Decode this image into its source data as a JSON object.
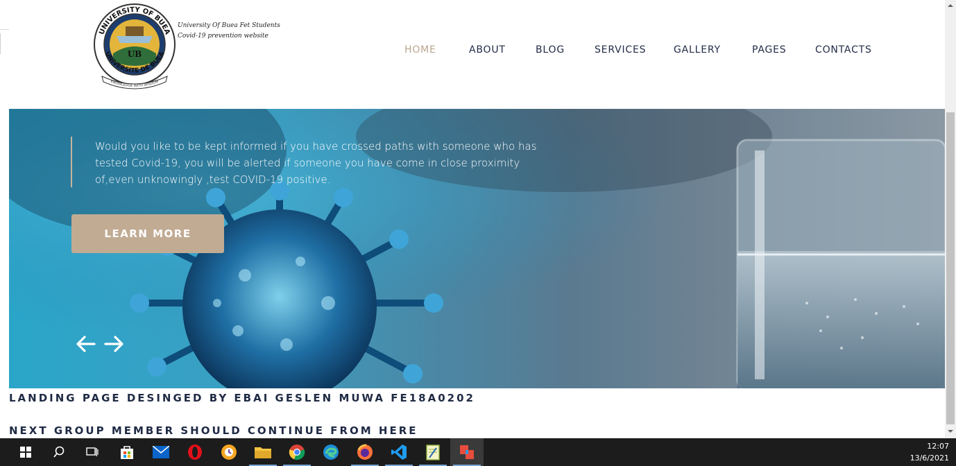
{
  "header": {
    "logo_caption_line1": "University Of Buea Fet Students",
    "logo_caption_line2": "Covid-19 prevention website",
    "logo_ring_top": "UNIVERSITY OF BUEA",
    "logo_ring_bottom": "UNIVERSITE DE BUEA",
    "logo_motto": "KNOWLEDGE WITH WISDOM",
    "logo_center": "UB"
  },
  "nav": {
    "items": [
      {
        "label": "HOME",
        "active": true
      },
      {
        "label": "ABOUT"
      },
      {
        "label": "BLOG"
      },
      {
        "label": "SERVICES"
      },
      {
        "label": "GALLERY"
      },
      {
        "label": "PAGES"
      },
      {
        "label": "CONTACTS"
      }
    ]
  },
  "hero": {
    "text": "Would you like to be kept informed if you have crossed paths with someone who has tested Covid-19, you will be alerted if someone you have come in close proximity of,even unknowingly ,test COVID-19 positive.",
    "button_label": "LEARN MORE",
    "prev_icon": "arrow-left-icon",
    "next_icon": "arrow-right-icon"
  },
  "footer": {
    "line1": "LANDING PAGE DESINGED BY EBAI GESLEN MUWA FE18A0202",
    "line2": "NEXT GROUP MEMBER SHOULD CONTINUE FROM HERE"
  },
  "taskbar": {
    "items": [
      "windows-start-icon",
      "search-icon",
      "task-view-icon",
      "store-icon",
      "mail-icon",
      "opera-icon",
      "browser-icon",
      "file-explorer-icon",
      "chrome-icon",
      "edge-icon",
      "firefox-icon",
      "vscode-icon",
      "notepad-icon",
      "app-icon"
    ],
    "time": "12:07",
    "date": "13/6/2021"
  },
  "colors": {
    "accent": "#c1ab93",
    "nav_text": "#222c47",
    "nav_active": "#b9a58f",
    "taskbar": "#1c1c1c"
  }
}
